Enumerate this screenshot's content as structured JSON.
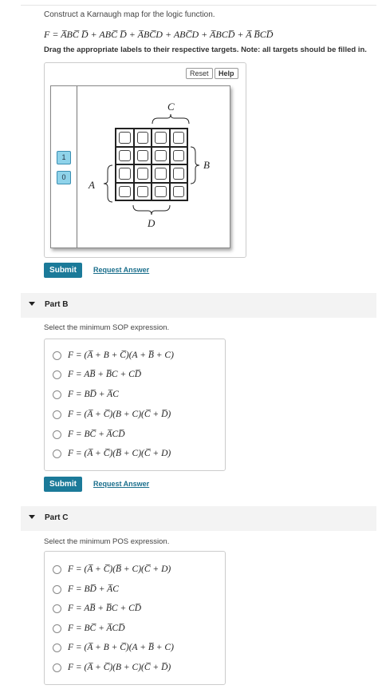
{
  "part_a": {
    "prompt": "Construct a Karnaugh map for the logic function.",
    "formula": "F = A̅BC̅ D̅ + ABC̅ D̅ + A̅BC̅D + ABC̅D + A̅BCD̅ + A̅ B̅CD̅",
    "instruction": "Drag the appropriate labels to their respective targets. Note: all targets should be filled in.",
    "reset_label": "Reset",
    "help_label": "Help",
    "chips": [
      "1",
      "0"
    ],
    "kmap": {
      "label_a": "A",
      "label_b": "B",
      "label_c": "C",
      "label_d": "D"
    },
    "submit_label": "Submit",
    "request_label": "Request Answer"
  },
  "part_b": {
    "title": "Part B",
    "question": "Select the minimum SOP expression.",
    "options": [
      "F = (A̅ + B + C̅)(A + B̅ + C)",
      "F = AB̅ + B̅C + CD̅",
      "F = BD̅ + A̅C",
      "F = (A̅ + C̅)(B + C)(C̅ + D̅)",
      "F = BC̅ + A̅CD̅",
      "F = (A̅ + C̅)(B̅ + C)(C̅ + D)"
    ],
    "submit_label": "Submit",
    "request_label": "Request Answer"
  },
  "part_c": {
    "title": "Part C",
    "question": "Select the minimum POS expression.",
    "options": [
      "F = (A̅ + C̅)(B̅ + C)(C̅ + D)",
      "F = BD̅ + A̅C",
      "F = AB̅ + B̅C + CD̅",
      "F = BC̅ + A̅CD̅",
      "F = (A̅ + B + C̅)(A + B̅ + C)",
      "F = (A̅ + C̅)(B + C)(C̅ + D̅)"
    ]
  }
}
